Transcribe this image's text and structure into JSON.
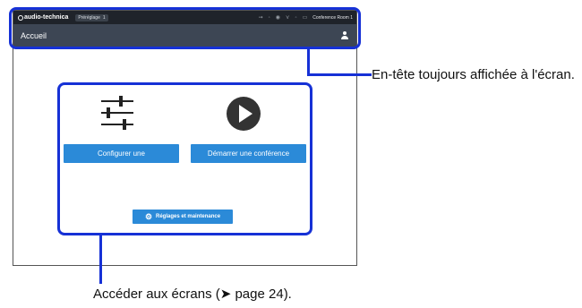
{
  "topbar": {
    "brand": "audio-technica",
    "preset_label": "Préréglage",
    "preset_value": "1",
    "room_name": "Conference Room 1"
  },
  "header": {
    "title": "Accueil"
  },
  "home": {
    "configure_label": "Configurer une",
    "start_label": "Démarrer une conférence",
    "settings_label": "Réglages et maintenance"
  },
  "annotations": {
    "header_note": "En-tête toujours affichée à l'écran.",
    "screens_note": "Accéder aux écrans (➤ page 24)."
  },
  "colors": {
    "header_bg": "#3d4654",
    "topbar_bg": "#1f232a",
    "button_blue": "#2b8ad8",
    "callout_blue": "#1631d6"
  }
}
